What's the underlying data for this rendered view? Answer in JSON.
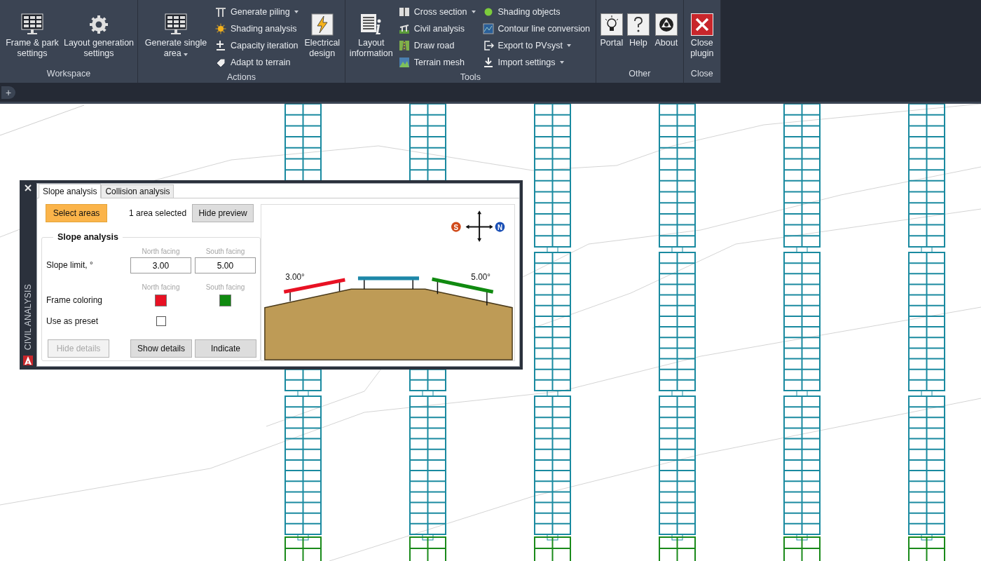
{
  "ribbon": {
    "groups": [
      {
        "title": "Workspace",
        "columns": [
          {
            "kind": "large",
            "label": "Frame & park settings",
            "dropdown": false
          },
          {
            "kind": "large",
            "label": "Layout generation settings",
            "dropdown": false
          }
        ]
      },
      {
        "title": "Actions",
        "columns": [
          {
            "kind": "large",
            "label": "Generate single area",
            "dropdown": true
          },
          {
            "kind": "stack",
            "items": [
              {
                "label": "Generate piling",
                "dropdown": true
              },
              {
                "label": "Shading analysis",
                "dropdown": false
              },
              {
                "label": "Capacity iteration",
                "dropdown": false
              },
              {
                "label": "Adapt to terrain",
                "dropdown": false
              }
            ]
          },
          {
            "kind": "large",
            "label": "Electrical design",
            "dropdown": false
          }
        ]
      },
      {
        "title": "Tools",
        "columns": [
          {
            "kind": "large",
            "label": "Layout information",
            "dropdown": false
          },
          {
            "kind": "stack",
            "items": [
              {
                "label": "Cross section",
                "dropdown": true
              },
              {
                "label": "Civil analysis",
                "dropdown": false
              },
              {
                "label": "Draw road",
                "dropdown": false
              },
              {
                "label": "Terrain mesh",
                "dropdown": false
              }
            ]
          },
          {
            "kind": "stack",
            "items": [
              {
                "label": "Shading objects",
                "dropdown": false
              },
              {
                "label": "Contour line conversion",
                "dropdown": false
              },
              {
                "label": "Export to PVsyst",
                "dropdown": true
              },
              {
                "label": "Import settings",
                "dropdown": true
              }
            ]
          }
        ]
      },
      {
        "title": "Other",
        "columns": [
          {
            "kind": "large",
            "label": "Portal",
            "dropdown": false
          },
          {
            "kind": "large",
            "label": "Help",
            "dropdown": false
          },
          {
            "kind": "large",
            "label": "About",
            "dropdown": false
          }
        ]
      },
      {
        "title": "Close",
        "columns": [
          {
            "kind": "large",
            "label": "Close plugin",
            "dropdown": false
          }
        ]
      }
    ]
  },
  "doc_tabs": {
    "new_tab": "+"
  },
  "palette": {
    "title": "CIVIL ANALYSIS",
    "tabs": [
      {
        "label": "Slope analysis",
        "selected": true
      },
      {
        "label": "Collision analysis",
        "selected": false
      }
    ],
    "select_button": {
      "label": "Select areas",
      "active": true
    },
    "selection_status": "1 area selected",
    "preview_button": "Hide preview",
    "group": {
      "title": "Slope analysis",
      "slope_limit": {
        "label": "Slope limit, °",
        "headers": [
          "North facing",
          "South facing"
        ],
        "values": [
          "3.00",
          "5.00"
        ]
      },
      "frame_coloring": {
        "label": "Frame coloring",
        "headers": [
          "North facing",
          "South facing"
        ],
        "swatches": [
          {
            "color": "#e81123"
          },
          {
            "color": "#108a10"
          }
        ]
      },
      "preset": {
        "label": "Use as preset",
        "checked": false
      },
      "buttons": [
        {
          "label": "Hide details",
          "disabled": true
        },
        {
          "label": "Show details",
          "disabled": false
        },
        {
          "label": "Indicate",
          "disabled": false
        }
      ]
    },
    "preview": {
      "north_angle": "3.00°",
      "south_angle": "5.00°",
      "south_marker": "S",
      "north_marker": "N"
    }
  }
}
